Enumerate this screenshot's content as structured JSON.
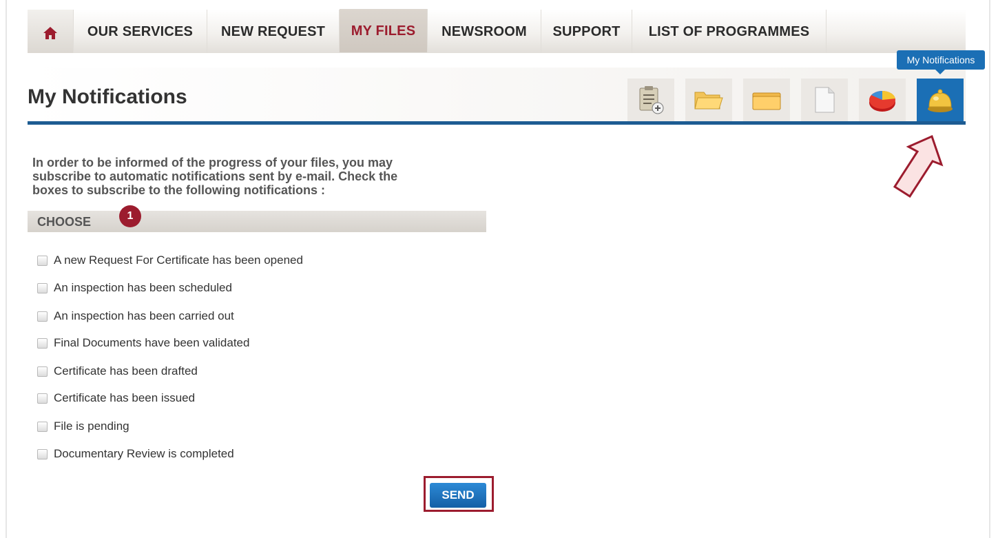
{
  "nav": {
    "items": [
      {
        "label": "OUR SERVICES"
      },
      {
        "label": "NEW REQUEST"
      },
      {
        "label": "MY FILES",
        "active": true
      },
      {
        "label": "NEWSROOM"
      },
      {
        "label": "SUPPORT"
      },
      {
        "label": "LIST OF PROGRAMMES"
      }
    ]
  },
  "page": {
    "title": "My Notifications"
  },
  "toolbar": {
    "icons": [
      "new-request-clipboard-icon",
      "open-folder-icon",
      "closed-folder-icon",
      "document-icon",
      "pie-chart-icon",
      "notification-bell-icon"
    ],
    "tooltip": "My Notifications"
  },
  "intro": {
    "line1": "In order to be informed of the progress of your files, you may",
    "line2": "subscribe to automatic notifications sent by e-mail. Check the",
    "line3": "boxes to subscribe to the following notifications :"
  },
  "choose": {
    "label": "CHOOSE",
    "badge": "1"
  },
  "options": [
    "A new Request For Certificate has been opened",
    "An inspection has been scheduled",
    "An inspection has been carried out",
    "Final Documents have been validated",
    "Certificate has been drafted",
    "Certificate has been issued",
    "File is pending",
    "Documentary Review is completed"
  ],
  "send_label": "SEND",
  "colors": {
    "accent_red": "#9c1c2e",
    "accent_blue": "#1b6fb5",
    "rule_blue": "#1d5c92"
  }
}
